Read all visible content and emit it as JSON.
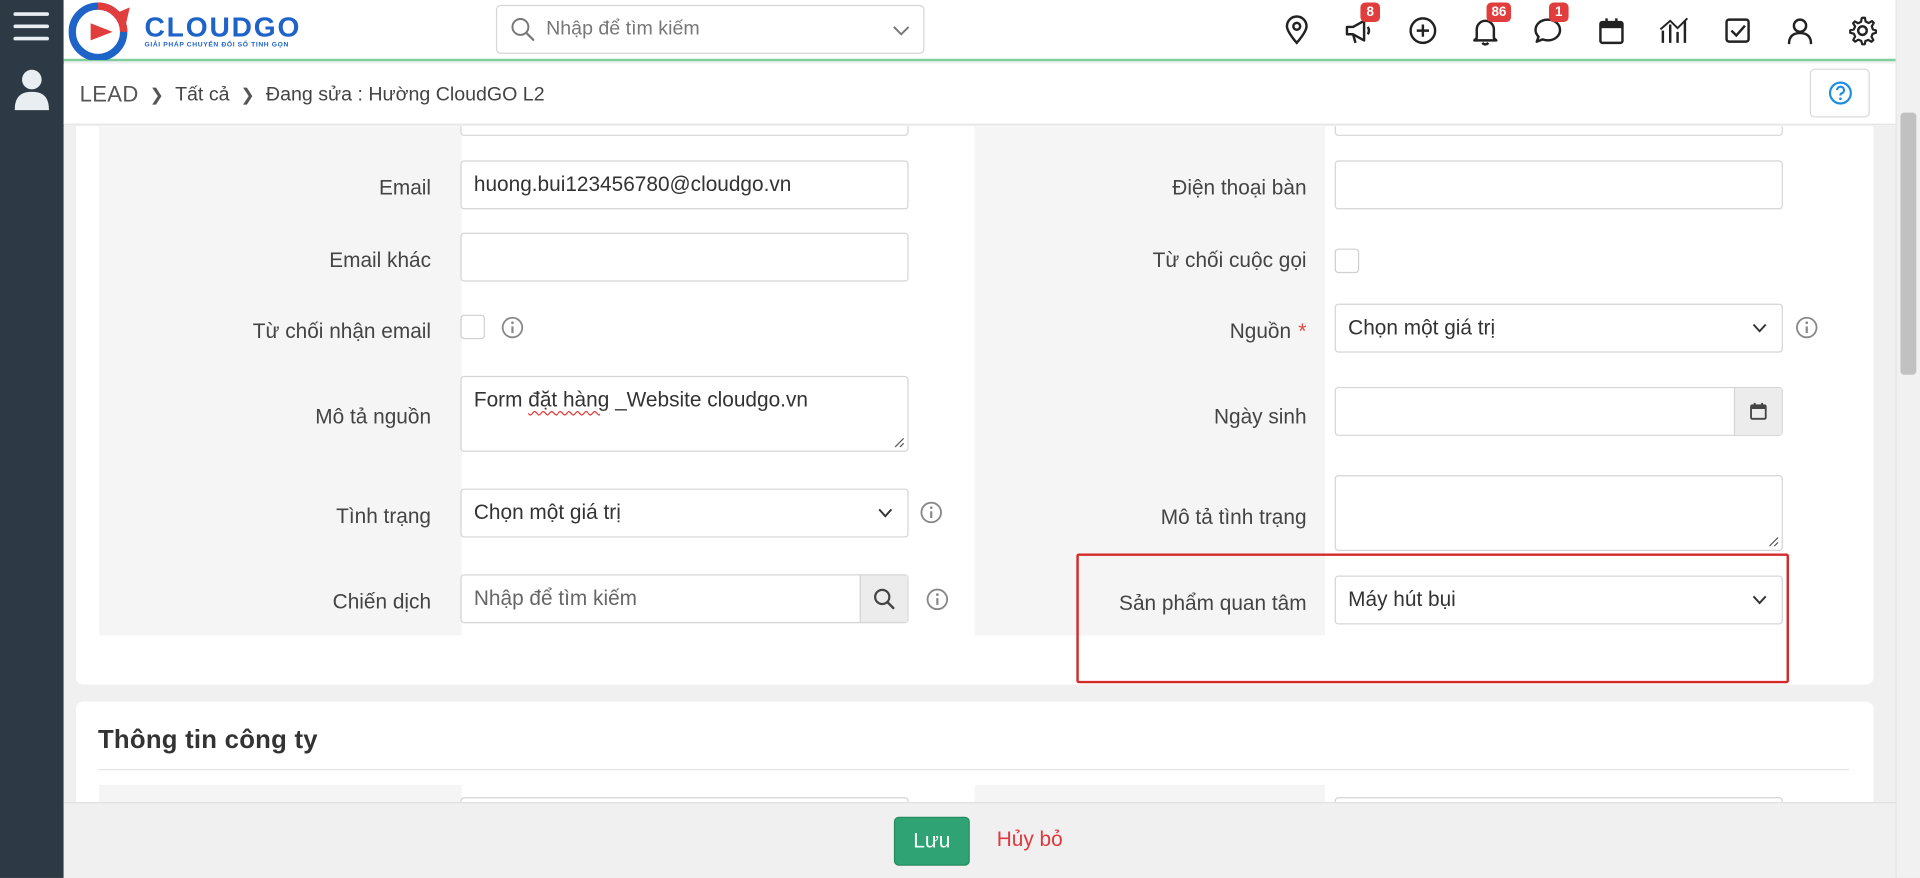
{
  "app": {
    "logo_word": "CLOUDGO",
    "logo_tagline": "GIẢI PHÁP CHUYỂN ĐỔI SỐ TINH GỌN"
  },
  "topbar": {
    "search_placeholder": "Nhập để tìm kiếm",
    "icons": [
      {
        "name": "location-pin-icon",
        "badge": ""
      },
      {
        "name": "megaphone-icon",
        "badge": "8"
      },
      {
        "name": "plus-circle-icon",
        "badge": ""
      },
      {
        "name": "bell-icon",
        "badge": "86"
      },
      {
        "name": "chat-icon",
        "badge": "1"
      },
      {
        "name": "calendar-icon",
        "badge": ""
      },
      {
        "name": "chart-icon",
        "badge": ""
      },
      {
        "name": "checkbox-task-icon",
        "badge": ""
      },
      {
        "name": "user-icon",
        "badge": ""
      },
      {
        "name": "gear-icon",
        "badge": ""
      }
    ]
  },
  "breadcrumb": {
    "root": "LEAD",
    "level1": "Tất cả",
    "level2": "Đang sửa : Hường CloudGO L2"
  },
  "form_left": {
    "email_label": "Email",
    "email_value": "huong.bui123456780@cloudgo.vn",
    "email_other_label": "Email khác",
    "email_other_value": "",
    "reject_email_label": "Từ chối nhận email",
    "source_desc_label": "Mô tả nguồn",
    "source_desc_value_part1": "Form ",
    "source_desc_value_misspelled": "đặt hàng",
    "source_desc_value_part2": " _Website cloudgo.vn",
    "status_label": "Tình trạng",
    "status_value": "Chọn một giá trị",
    "campaign_label": "Chiến dịch",
    "campaign_placeholder": "Nhập để tìm kiếm"
  },
  "form_right": {
    "phone_label": "Điện thoại bàn",
    "phone_value": "",
    "reject_call_label": "Từ chối cuộc gọi",
    "source_label": "Nguồn",
    "source_required": "*",
    "source_value": "Chọn một giá trị",
    "birthday_label": "Ngày sinh",
    "birthday_value": "",
    "status_desc_label": "Mô tả tình trạng",
    "status_desc_value": "",
    "product_label": "Sản phẩm quan tâm",
    "product_value": "Máy hút bụi"
  },
  "section": {
    "company_title": "Thông tin công ty"
  },
  "footer": {
    "save_label": "Lưu",
    "cancel_label": "Hủy bỏ"
  },
  "colors": {
    "sidebar": "#2d3a45",
    "brand_blue": "#1e63c8",
    "brand_red": "#e23d3d",
    "save_green": "#2fa373",
    "highlight_red": "#d42a2a"
  }
}
